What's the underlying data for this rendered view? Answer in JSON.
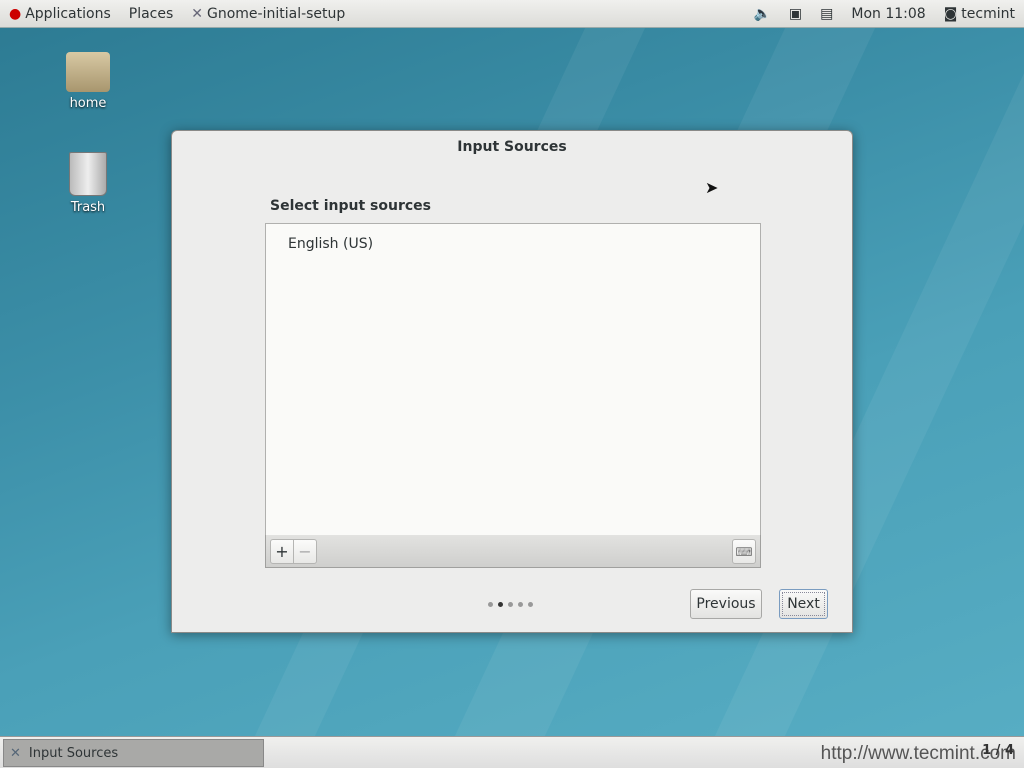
{
  "topbar": {
    "applications": "Applications",
    "places": "Places",
    "app_name": "Gnome-initial-setup",
    "clock": "Mon 11:08",
    "user": "tecmint"
  },
  "desktop": {
    "icons": [
      {
        "label": "home"
      },
      {
        "label": "Trash"
      }
    ]
  },
  "dialog": {
    "title": "Input Sources",
    "section_label": "Select input sources",
    "sources": [
      "English (US)"
    ],
    "add_label": "+",
    "remove_label": "−",
    "page_count": 5,
    "current_page": 2,
    "previous_label": "Previous",
    "next_label": "Next"
  },
  "taskbar": {
    "task_label": "Input Sources",
    "workspace": "1 / 4",
    "watermark": "http://www.tecmint.com"
  }
}
